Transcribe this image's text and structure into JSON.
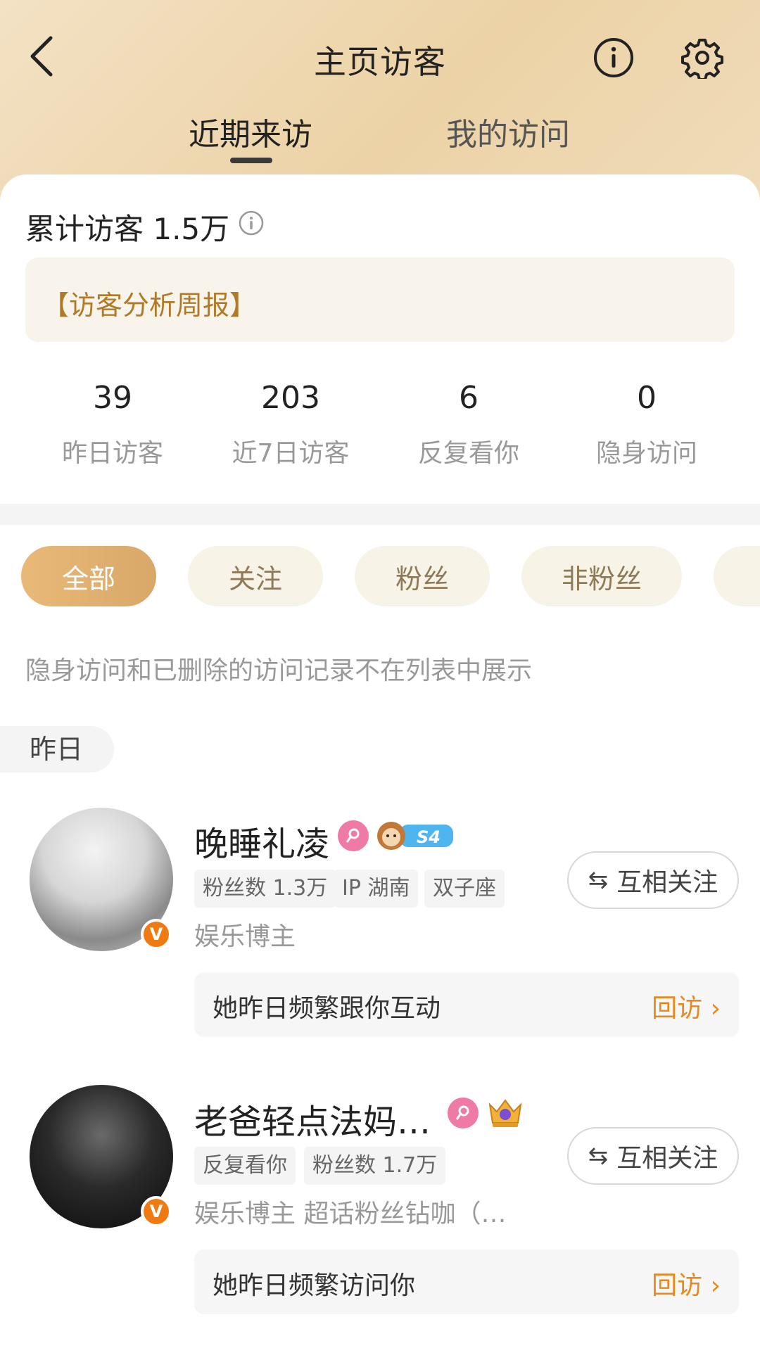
{
  "header": {
    "title": "主页访客",
    "tabs": [
      {
        "label": "近期来访",
        "active": true
      },
      {
        "label": "我的访问",
        "active": false
      }
    ]
  },
  "summary": {
    "total_label": "累计访客 1.5万",
    "report_label": "【访客分析周报】"
  },
  "stats": [
    {
      "value": "39",
      "label": "昨日访客"
    },
    {
      "value": "203",
      "label": "近7日访客"
    },
    {
      "value": "6",
      "label": "反复看你"
    },
    {
      "value": "0",
      "label": "隐身访问"
    }
  ],
  "filters": [
    {
      "label": "全部",
      "active": true
    },
    {
      "label": "关注",
      "active": false
    },
    {
      "label": "粉丝",
      "active": false
    },
    {
      "label": "非粉丝",
      "active": false
    }
  ],
  "notice": "隐身访问和已删除的访问记录不在列表中展示",
  "section_date": "昨日",
  "visitors": [
    {
      "name": "晚睡礼凌",
      "tags": [
        "粉丝数 1.3万",
        "IP 湖南",
        "双子座"
      ],
      "badge_text": "S4",
      "description": "娱乐博主",
      "follow_label": "互相关注",
      "hint": "她昨日频繁跟你互动",
      "revisit_label": "回访 ›"
    },
    {
      "name": "老爸轻点法妈…",
      "tags": [
        "反复看你",
        "粉丝数 1.7万"
      ],
      "description": "娱乐博主 超话粉丝钻咖（…",
      "follow_label": "互相关注",
      "hint": "她昨日频繁访问你",
      "revisit_label": "回访 ›"
    }
  ],
  "colors": {
    "accent_orange": "#e8891c",
    "report_gold": "#b07a26",
    "chip_active": "#dfae6e",
    "header_gradient": "#ecd2a6"
  }
}
